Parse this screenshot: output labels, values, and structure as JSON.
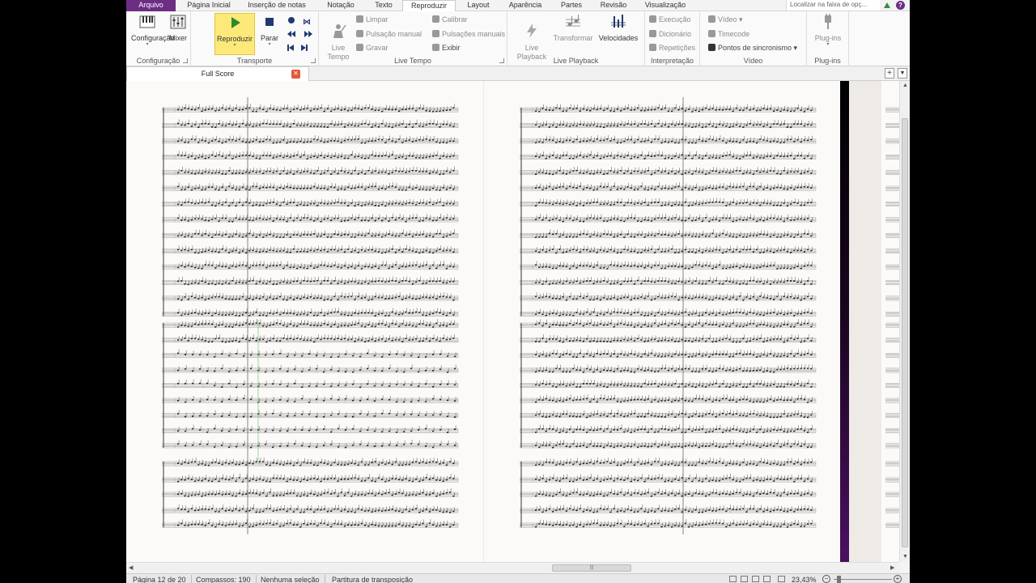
{
  "menu": {
    "tabs": [
      "Arquivo",
      "Página Inicial",
      "Inserção de notas",
      "Notação",
      "Texto",
      "Reproduzir",
      "Layout",
      "Aparência",
      "Partes",
      "Revisão",
      "Visualização"
    ],
    "active": "Reproduzir",
    "search_placeholder": "Localizar na faixa de opç..."
  },
  "ribbon": {
    "configuracao": {
      "label": "Configuração",
      "configuracao_btn": "Configuração",
      "mixer_btn": "Mixer"
    },
    "transporte": {
      "label": "Transporte",
      "play_btn": "Reproduzir",
      "stop_btn": "Parar"
    },
    "live_tempo": {
      "label": "Live Tempo",
      "live_tempo_btn": "Live\nTempo",
      "limpar": "Limpar",
      "pulsacao_manual": "Pulsação manual",
      "gravar": "Gravar",
      "calibrar": "Calibrar",
      "pulsacoes_manuais": "Pulsações manuais",
      "exibir": "Exibir"
    },
    "live_playback": {
      "label": "Live Playback",
      "live_playback_btn": "Live\nPlayback",
      "transformar_btn": "Transformar",
      "velocidades_btn": "Velocidades"
    },
    "interpretacao": {
      "label": "Interpretação",
      "execucao": "Execução",
      "dicionario": "Dicionário",
      "repeticoes": "Repetições"
    },
    "video": {
      "label": "Vídeo",
      "video_btn": "Vídeo",
      "timecode": "Timecode",
      "pontos": "Pontos de sincronismo"
    },
    "plugins": {
      "label": "Plug-ins",
      "plugins_btn": "Plug-ins"
    }
  },
  "document": {
    "tab_title": "Full Score"
  },
  "status": {
    "page": "Página 12 de 20",
    "bars": "Compassos: 190",
    "selection": "Nenhuma seleção",
    "transposition": "Partitura de transposição",
    "zoom": "23,43%"
  },
  "colors": {
    "accent": "#6b2e83",
    "play_highlight": "#fde97a"
  }
}
